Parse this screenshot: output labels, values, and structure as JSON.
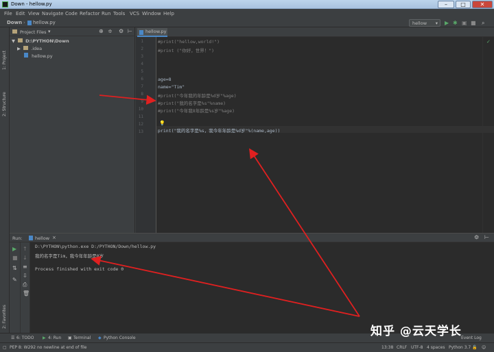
{
  "window": {
    "title": "Down - hellow.py",
    "minimize": "–",
    "maximize": "□",
    "close": "✕"
  },
  "menu": [
    "File",
    "Edit",
    "View",
    "Navigate",
    "Code",
    "Refactor",
    "Run",
    "Tools",
    "VCS",
    "Window",
    "Help"
  ],
  "navbar": {
    "project": "Down",
    "file": "hellow.py",
    "run_config": "hellow"
  },
  "left_strip": {
    "project_tab": "1: Project",
    "structure_tab": "2: Structure",
    "favorites_tab": "2: Favorites"
  },
  "project_panel": {
    "title": "Project Files",
    "root": "D:\\PYTHON\\Down",
    "items": [
      ".idea",
      "hellow.py"
    ]
  },
  "editor": {
    "tab": "hellow.py",
    "line_numbers": [
      "1",
      "2",
      "3",
      "4",
      "5",
      "6",
      "7",
      "8",
      "9",
      "10",
      "11",
      "12",
      "13"
    ],
    "lines": [
      "#print(\"hellow,world!\")",
      "#print (\"你好，世界！\")",
      "",
      "",
      "",
      "age=8",
      "name=\"Tim\"",
      "#print(\"今年我的年龄是%d岁\"%age)",
      "#print(\"我的名字是%s\"%name)",
      "#print(\"今年我8年龄是%s岁\"%age)",
      "",
      "",
      "print(\"我的名字是%s，我今年年龄是%d岁\"%(name,age))"
    ],
    "code_colors": {
      "comment": "#808080",
      "string": "#6a8759",
      "builtin": "#8888c6",
      "plain": "#a9b7c6"
    }
  },
  "run_panel": {
    "label": "Run:",
    "config": "hellow",
    "output": [
      "D:\\PYTHON\\python.exe D:/PYTHON/Down/hellow.py",
      "我的名字是Tim，我今年年龄是8岁",
      "",
      "Process finished with exit code 0"
    ]
  },
  "bottom_tabs": [
    "6: TODO",
    "4: Run",
    "Terminal",
    "Python Console",
    "Event Log"
  ],
  "status": {
    "message": "PEP 8: W292 no newline at end of file",
    "position": "13:38",
    "line_sep": "CRLF",
    "encoding": "UTF-8",
    "indent": "4 spaces",
    "interpreter": "Python 3.7"
  },
  "watermark": "知乎 @云天学长",
  "annotation_color": "#e02020"
}
